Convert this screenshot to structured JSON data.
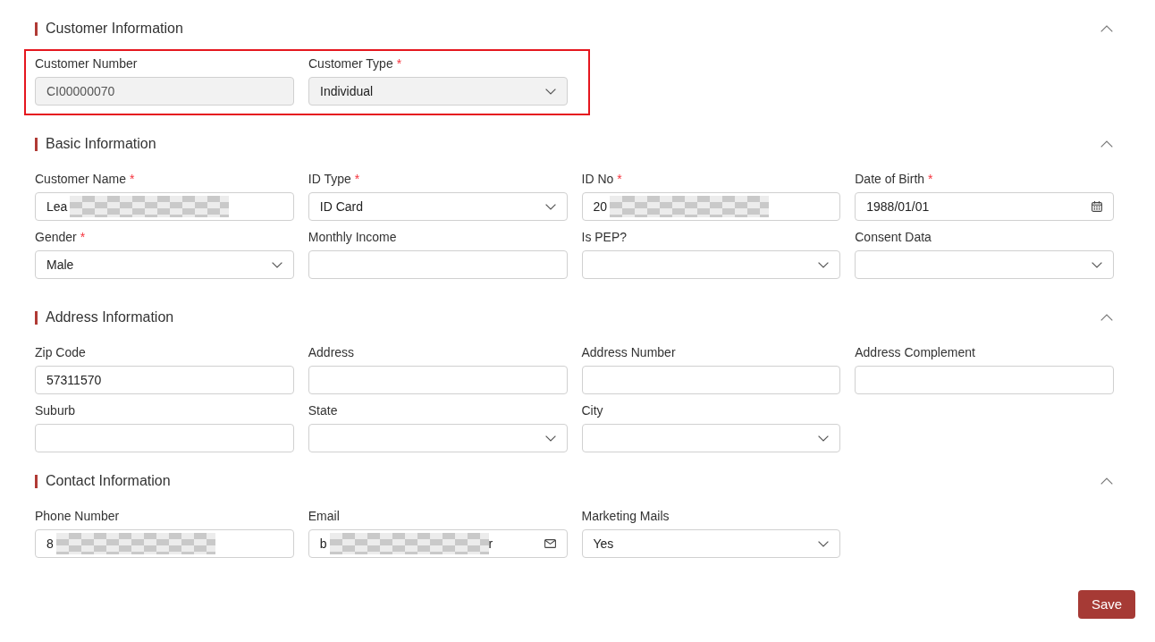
{
  "sections": [
    {
      "title": "Customer Information",
      "expanded": true,
      "highlighted": true,
      "fields": [
        {
          "label": "Customer Number",
          "kind": "text",
          "value": "CI00000070",
          "disabled": true,
          "redacted": false
        },
        {
          "label": "Customer Type",
          "required_mark": "*",
          "kind": "select",
          "value": "Individual",
          "disabled": true,
          "redacted": false
        }
      ]
    },
    {
      "title": "Basic Information",
      "expanded": true,
      "highlighted": false,
      "fields": [
        {
          "label": "Customer Name",
          "required_mark": "*",
          "kind": "text",
          "value": "Lea",
          "disabled": false,
          "redacted": true
        },
        {
          "label": "ID Type",
          "required_mark": "*",
          "kind": "select",
          "value": "ID Card",
          "disabled": false,
          "redacted": false
        },
        {
          "label": "ID No",
          "required_mark": "*",
          "kind": "text",
          "value": "20",
          "disabled": false,
          "redacted": true
        },
        {
          "label": "Date of Birth",
          "required_mark": "*",
          "kind": "date",
          "value": "1988/01/01",
          "disabled": false,
          "redacted": false
        },
        {
          "label": "Gender",
          "required_mark": "*",
          "kind": "select",
          "value": "Male",
          "disabled": false,
          "redacted": false
        },
        {
          "label": "Monthly Income",
          "kind": "text",
          "disabled": false,
          "redacted": false
        },
        {
          "label": "Is PEP?",
          "kind": "select",
          "disabled": false,
          "redacted": false
        },
        {
          "label": "Consent Data",
          "kind": "select",
          "disabled": false,
          "redacted": false
        }
      ]
    },
    {
      "title": "Address Information",
      "expanded": true,
      "highlighted": false,
      "fields": [
        {
          "label": "Zip Code",
          "kind": "text",
          "value": "57311570",
          "disabled": false,
          "redacted": false
        },
        {
          "label": "Address",
          "kind": "text",
          "disabled": false,
          "redacted": false
        },
        {
          "label": "Address Number",
          "kind": "text",
          "disabled": false,
          "redacted": false
        },
        {
          "label": "Address Complement",
          "kind": "text",
          "disabled": false,
          "redacted": false
        },
        {
          "label": "Suburb",
          "kind": "text",
          "disabled": false,
          "redacted": false
        },
        {
          "label": "State",
          "kind": "select",
          "disabled": false,
          "redacted": false
        },
        {
          "label": "City",
          "kind": "select",
          "disabled": false,
          "redacted": false
        }
      ]
    },
    {
      "title": "Contact Information",
      "expanded": true,
      "highlighted": false,
      "fields": [
        {
          "label": "Phone Number",
          "kind": "text",
          "value": "8",
          "disabled": false,
          "redacted": true
        },
        {
          "label": "Email",
          "kind": "email",
          "value": "b",
          "value_tail": "r",
          "disabled": false,
          "redacted": true
        },
        {
          "label": "Marketing Mails",
          "kind": "select",
          "value": "Yes",
          "disabled": false,
          "redacted": false
        }
      ]
    }
  ],
  "save_button": {
    "label": "Save"
  }
}
